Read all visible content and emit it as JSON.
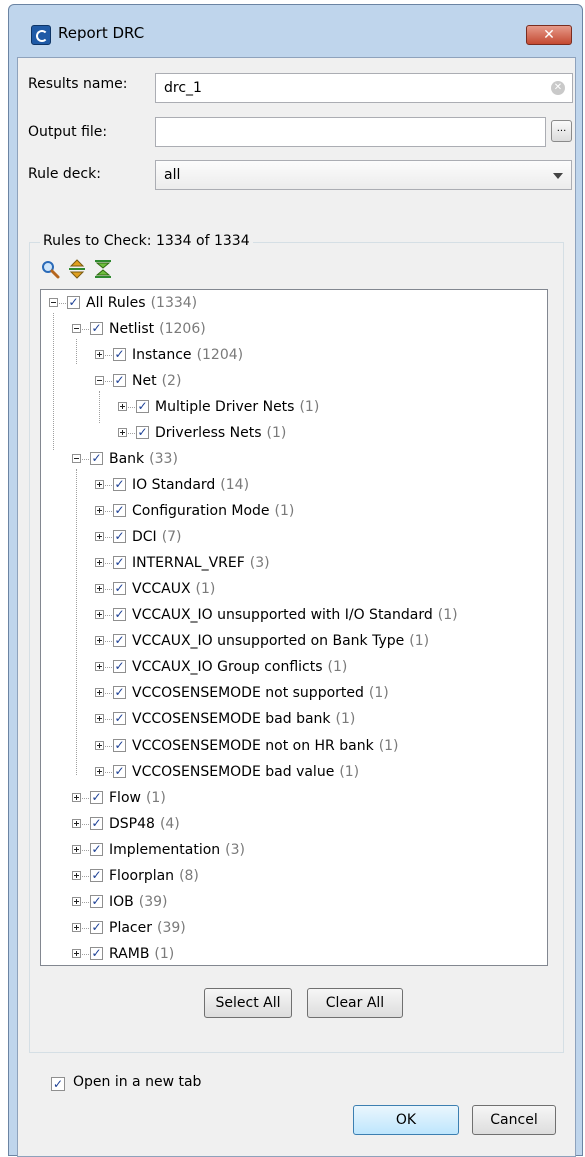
{
  "window": {
    "title": "Report DRC",
    "close_glyph": "✕"
  },
  "fields": {
    "results_name_label": "Results name:",
    "results_name_value": "drc_1",
    "output_file_label": "Output file:",
    "output_file_value": "",
    "browse_label": "...",
    "rule_deck_label": "Rule deck:",
    "rule_deck_value": "all"
  },
  "rules_group": {
    "title": "Rules to Check: 1334 of 1334"
  },
  "toolbar_icons": [
    "search-icon",
    "expand-all-icon",
    "collapse-all-icon"
  ],
  "tree": [
    {
      "label": "All Rules",
      "count": "(1334)",
      "level": 0,
      "expanded": true,
      "checked": true
    },
    {
      "label": "Netlist",
      "count": "(1206)",
      "level": 1,
      "expanded": true,
      "checked": true
    },
    {
      "label": "Instance",
      "count": "(1204)",
      "level": 2,
      "expanded": false,
      "checked": true
    },
    {
      "label": "Net",
      "count": "(2)",
      "level": 2,
      "expanded": true,
      "checked": true
    },
    {
      "label": "Multiple Driver Nets",
      "count": "(1)",
      "level": 3,
      "expanded": false,
      "checked": true
    },
    {
      "label": "Driverless Nets",
      "count": "(1)",
      "level": 3,
      "expanded": false,
      "checked": true
    },
    {
      "label": "Bank",
      "count": "(33)",
      "level": 1,
      "expanded": true,
      "checked": true
    },
    {
      "label": "IO Standard",
      "count": "(14)",
      "level": 2,
      "expanded": false,
      "checked": true
    },
    {
      "label": "Configuration Mode",
      "count": "(1)",
      "level": 2,
      "expanded": false,
      "checked": true
    },
    {
      "label": "DCI",
      "count": "(7)",
      "level": 2,
      "expanded": false,
      "checked": true
    },
    {
      "label": "INTERNAL_VREF",
      "count": "(3)",
      "level": 2,
      "expanded": false,
      "checked": true
    },
    {
      "label": "VCCAUX",
      "count": "(1)",
      "level": 2,
      "expanded": false,
      "checked": true
    },
    {
      "label": "VCCAUX_IO unsupported with I/O Standard",
      "count": "(1)",
      "level": 2,
      "expanded": false,
      "checked": true
    },
    {
      "label": "VCCAUX_IO unsupported on Bank Type",
      "count": "(1)",
      "level": 2,
      "expanded": false,
      "checked": true
    },
    {
      "label": "VCCAUX_IO Group conflicts",
      "count": "(1)",
      "level": 2,
      "expanded": false,
      "checked": true
    },
    {
      "label": "VCCOSENSEMODE not supported",
      "count": "(1)",
      "level": 2,
      "expanded": false,
      "checked": true
    },
    {
      "label": "VCCOSENSEMODE bad bank",
      "count": "(1)",
      "level": 2,
      "expanded": false,
      "checked": true
    },
    {
      "label": "VCCOSENSEMODE not on HR bank",
      "count": "(1)",
      "level": 2,
      "expanded": false,
      "checked": true
    },
    {
      "label": "VCCOSENSEMODE bad value",
      "count": "(1)",
      "level": 2,
      "expanded": false,
      "checked": true
    },
    {
      "label": "Flow",
      "count": "(1)",
      "level": 1,
      "expanded": false,
      "checked": true
    },
    {
      "label": "DSP48",
      "count": "(4)",
      "level": 1,
      "expanded": false,
      "checked": true
    },
    {
      "label": "Implementation",
      "count": "(3)",
      "level": 1,
      "expanded": false,
      "checked": true
    },
    {
      "label": "Floorplan",
      "count": "(8)",
      "level": 1,
      "expanded": false,
      "checked": true
    },
    {
      "label": "IOB",
      "count": "(39)",
      "level": 1,
      "expanded": false,
      "checked": true
    },
    {
      "label": "Placer",
      "count": "(39)",
      "level": 1,
      "expanded": false,
      "checked": true
    },
    {
      "label": "RAMB",
      "count": "(1)",
      "level": 1,
      "expanded": false,
      "checked": true
    }
  ],
  "buttons": {
    "select_all": "Select All",
    "clear_all": "Clear All",
    "ok": "OK",
    "cancel": "Cancel"
  },
  "open_in_new_tab": {
    "label": "Open in a new tab",
    "checked": true
  },
  "colors": {
    "window_frame": "#bfd5ec",
    "count_text": "#7a7a7a",
    "check_mark": "#1c3f94"
  }
}
